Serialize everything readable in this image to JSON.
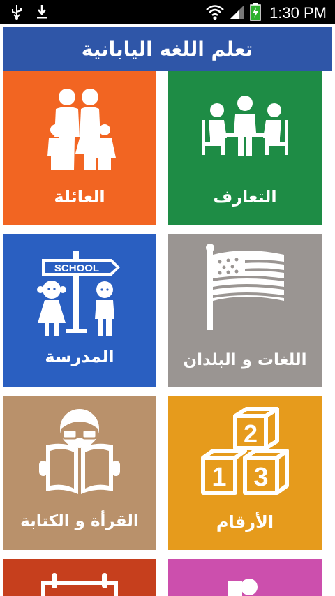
{
  "status_bar": {
    "time": "1:30 PM",
    "icons": [
      "usb-icon",
      "download-icon",
      "wifi-icon",
      "signal-icon",
      "battery-charging-icon"
    ]
  },
  "header": {
    "title": "تعلم اللغه اليابانية"
  },
  "tiles": [
    {
      "label": "العائلة",
      "icon": "family-icon",
      "color": "#f26522"
    },
    {
      "label": "التعارف",
      "icon": "meeting-icon",
      "color": "#1e8c45"
    },
    {
      "label": "المدرسة",
      "icon": "school-children-icon",
      "color": "#2a5fc1",
      "sign_text": "SCHOOL"
    },
    {
      "label": "اللغات و البلدان",
      "icon": "flag-icon",
      "color": "#9a9592"
    },
    {
      "label": "القرأة و الكتابة",
      "icon": "reading-icon",
      "color": "#b9916b"
    },
    {
      "label": "الأرقام",
      "icon": "number-blocks-icon",
      "color": "#e69b1c",
      "digits": [
        "2",
        "1",
        "3"
      ]
    },
    {
      "label": "",
      "icon": "calendar-icon",
      "color": "#c63f1d"
    },
    {
      "label": "",
      "icon": "person-icon",
      "color": "#cc4fad"
    }
  ]
}
